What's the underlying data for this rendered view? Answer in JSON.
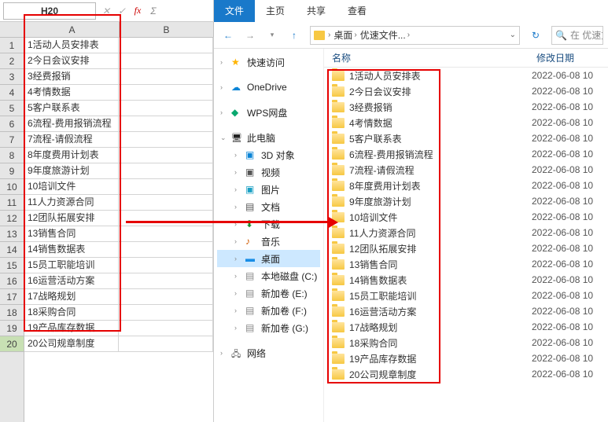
{
  "sheet": {
    "name_box": "H20",
    "col_headers": [
      "A",
      "B"
    ],
    "rows": [
      "1活动人员安排表",
      "2今日会议安排",
      "3经费报销",
      "4考情数据",
      "5客户联系表",
      "6流程-费用报销流程",
      "7流程-请假流程",
      "8年度费用计划表",
      "9年度旅游计划",
      "10培训文件",
      "11人力资源合同",
      "12团队拓展安排",
      "13销售合同",
      "14销售数据表",
      "15员工职能培训",
      "16运营活动方案",
      "17战略规划",
      "18采购合同",
      "19产品库存数据",
      "20公司规章制度"
    ]
  },
  "explorer": {
    "tabs": [
      "文件",
      "主页",
      "共享",
      "查看"
    ],
    "breadcrumbs": [
      "桌面",
      "优速文件..."
    ],
    "search_placeholder": "在 优速文",
    "nav": {
      "quick": "快速访问",
      "onedrive": "OneDrive",
      "wps": "WPS网盘",
      "pc": "此电脑",
      "pc_children": [
        "3D 对象",
        "视频",
        "图片",
        "文档",
        "下载",
        "音乐",
        "桌面",
        "本地磁盘 (C:)",
        "新加卷 (E:)",
        "新加卷 (F:)",
        "新加卷 (G:)"
      ],
      "network": "网络"
    },
    "columns": {
      "name": "名称",
      "date": "修改日期"
    },
    "files": [
      "1活动人员安排表",
      "2今日会议安排",
      "3经费报销",
      "4考情数据",
      "5客户联系表",
      "6流程-费用报销流程",
      "7流程-请假流程",
      "8年度费用计划表",
      "9年度旅游计划",
      "10培训文件",
      "11人力资源合同",
      "12团队拓展安排",
      "13销售合同",
      "14销售数据表",
      "15员工职能培训",
      "16运营活动方案",
      "17战略规划",
      "18采购合同",
      "19产品库存数据",
      "20公司规章制度"
    ],
    "date_value": "2022-06-08 10"
  }
}
